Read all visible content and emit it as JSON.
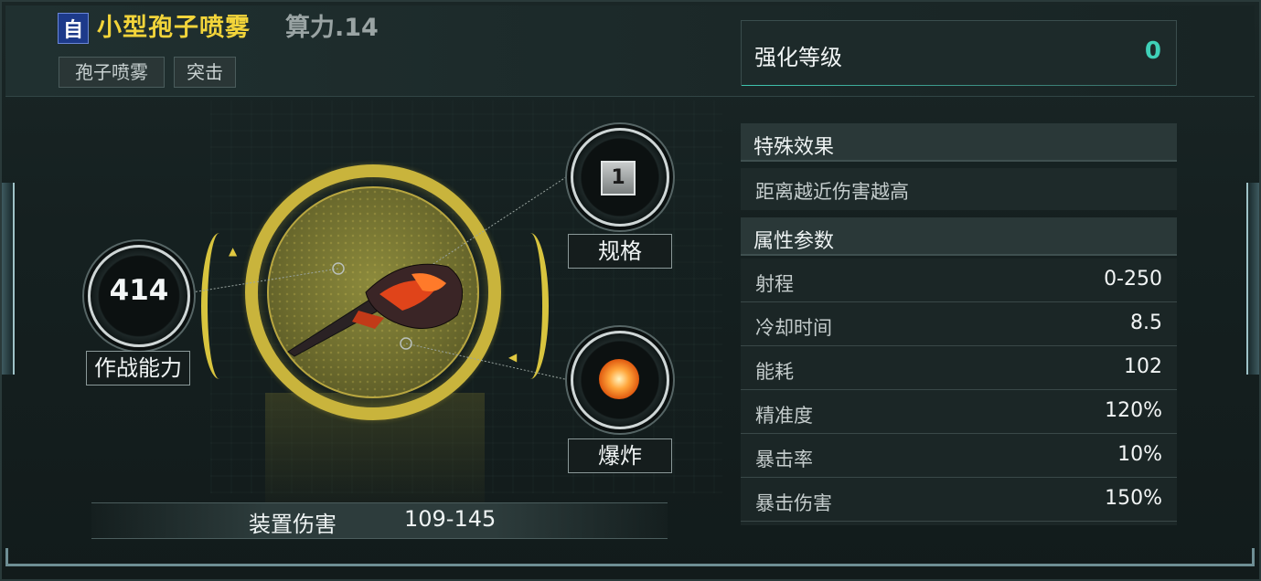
{
  "weapon": {
    "type_badge": "自",
    "name": "小型孢子喷雾",
    "compute_label": "算力.14",
    "tags": [
      "孢子喷雾",
      "突击"
    ]
  },
  "enhancement": {
    "label": "强化等级",
    "value": "0"
  },
  "special_effect": {
    "header": "特殊效果",
    "text": "距离越近伤害越高"
  },
  "attributes": {
    "header": "属性参数",
    "rows": [
      {
        "key": "射程",
        "value": "0-250"
      },
      {
        "key": "冷却时间",
        "value": "8.5"
      },
      {
        "key": "能耗",
        "value": "102"
      },
      {
        "key": "精准度",
        "value": "120%"
      },
      {
        "key": "暴击率",
        "value": "10%"
      },
      {
        "key": "暴击伤害",
        "value": "150%"
      }
    ]
  },
  "combat": {
    "value": "414",
    "label": "作战能力"
  },
  "spec": {
    "value": "1",
    "label": "规格"
  },
  "explosion": {
    "label": "爆炸",
    "icon": "explosion-icon"
  },
  "damage": {
    "label": "装置伤害",
    "value": "109-145"
  },
  "colors": {
    "title": "#f2d43a",
    "accent": "#3fd0b8",
    "ring": "#c9b43c"
  }
}
